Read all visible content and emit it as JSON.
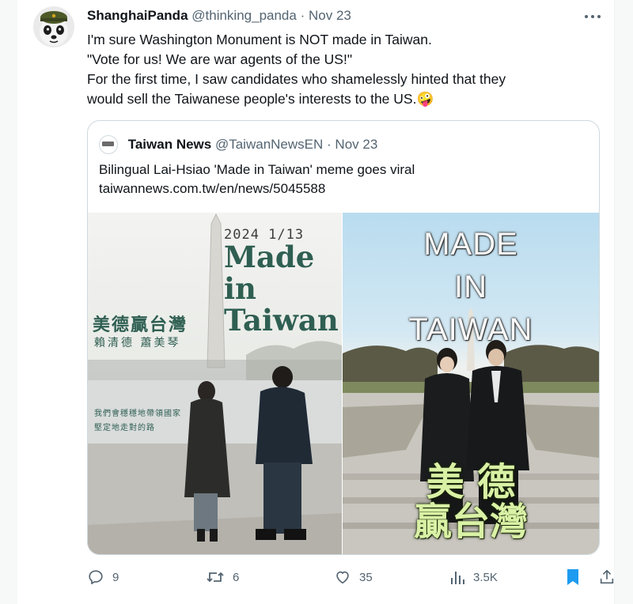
{
  "tweet": {
    "author_name": "ShanghaiPanda",
    "author_handle": "@thinking_panda",
    "separator": "·",
    "date": "Nov 23",
    "more_icon": "more-horizontal-icon",
    "lines": [
      "I'm sure Washington Monument is NOT made in Taiwan.",
      "\"Vote for us! We are war agents of the US!\"",
      "For the first time, I saw candidates who shamelessly hinted that they",
      "would sell the Taiwanese people's interests to the US."
    ],
    "emoji": "🤪"
  },
  "quote": {
    "author_name": "Taiwan News",
    "author_handle": "@TaiwanNewsEN",
    "separator": "·",
    "date": "Nov 23",
    "title": "Bilingual Lai-Hsiao 'Made in Taiwan' meme goes viral",
    "link": "taiwannews.com.tw/en/news/5045588",
    "logo_text": "Taiwan News",
    "image_left": {
      "date": "2024 1/13",
      "made": [
        "Made",
        "in",
        "Taiwan"
      ],
      "cn_slogan": "美德贏台灣",
      "cn_names": "賴清德  蕭美琴",
      "cn_small": [
        "我們會穩穩地帶領國家",
        "堅定地走對的路"
      ]
    },
    "image_right": {
      "made": [
        "MADE",
        "IN",
        "TAIWAN"
      ],
      "cn_line1": "美 德",
      "cn_line2": "贏台灣"
    }
  },
  "actions": {
    "reply_count": "9",
    "retweet_count": "6",
    "like_count": "35",
    "views_count": "3.5K",
    "icons": [
      "reply-icon",
      "retweet-icon",
      "like-icon",
      "views-icon",
      "bookmark-icon",
      "share-icon"
    ],
    "bookmark_color": "#1d9bf0",
    "muted_color": "#536471"
  }
}
